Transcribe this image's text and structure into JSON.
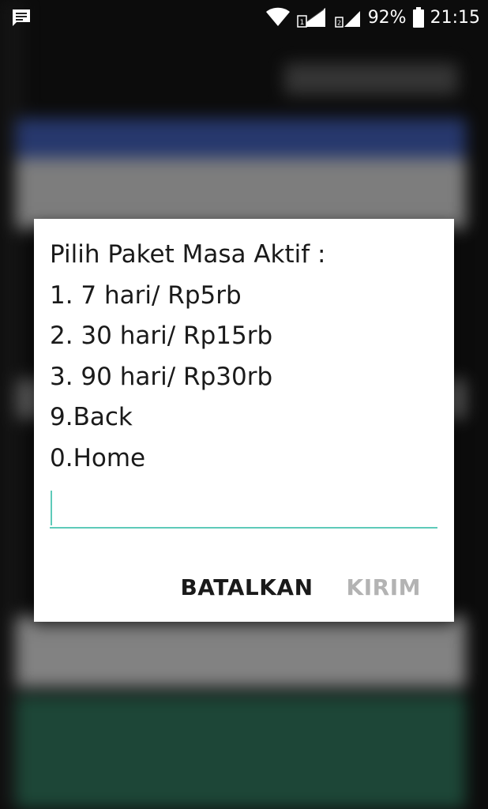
{
  "status_bar": {
    "battery_percent": "92%",
    "time": "21:15",
    "sim1_label": "1",
    "sim2_label": "2",
    "icons": [
      "message-icon",
      "wifi-icon",
      "signal-icon",
      "battery-icon"
    ]
  },
  "dialog": {
    "message_lines": [
      "Pilih Paket Masa Aktif :",
      "1. 7 hari/ Rp5rb",
      "2. 30 hari/ Rp15rb",
      "3. 90 hari/ Rp30rb",
      "9.Back",
      "0.Home"
    ],
    "input_value": "",
    "cancel_label": "BATALKAN",
    "send_label": "KIRIM"
  },
  "colors": {
    "accent": "#5ecab9",
    "disabled_text": "#b3b3b3",
    "dialog_bg": "#ffffff"
  }
}
